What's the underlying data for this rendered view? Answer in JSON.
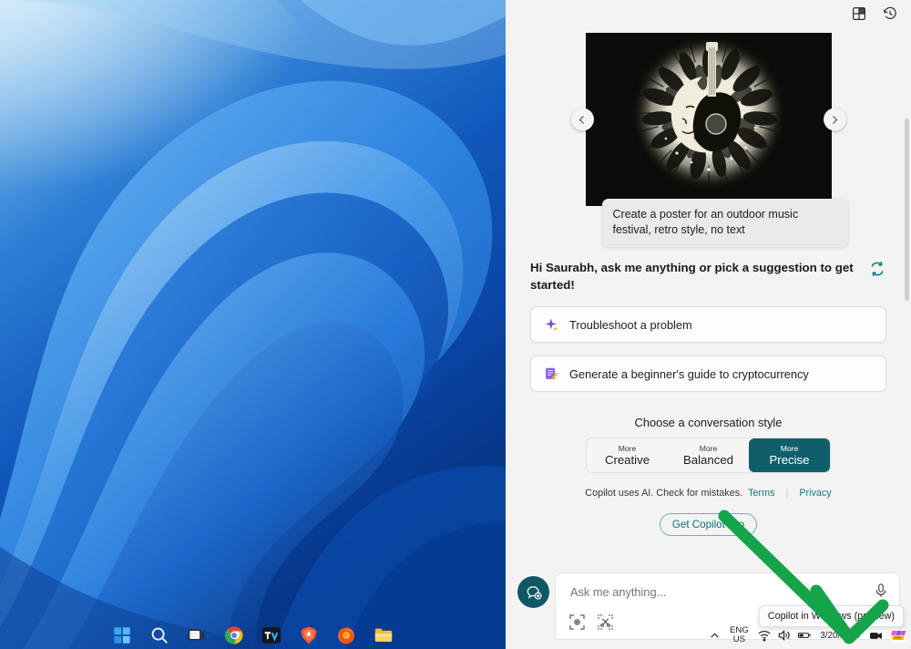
{
  "desktop": {
    "wallpaper_name": "windows-11-bloom-wallpaper",
    "taskbar": {
      "items": [
        {
          "name": "start-button",
          "label": "Start"
        },
        {
          "name": "search-button",
          "label": "Search"
        },
        {
          "name": "task-view-button",
          "label": "Task View"
        },
        {
          "name": "chrome-button",
          "label": "Google Chrome"
        },
        {
          "name": "tradingview-button",
          "label": "TradingView"
        },
        {
          "name": "brave-button",
          "label": "Brave Browser"
        },
        {
          "name": "firefox-button",
          "label": "Firefox"
        },
        {
          "name": "file-explorer-button",
          "label": "File Explorer"
        }
      ]
    },
    "tray": {
      "chevron_label": "Show hidden icons",
      "language": {
        "line1": "ENG",
        "line2": "US"
      },
      "wifi_label": "Network",
      "volume_label": "Volume",
      "battery_label": "Battery",
      "date": "3/20/2024",
      "meet_now_label": "Meet Now",
      "copilot_label": "Copilot in Windows (preview)",
      "tooltip": "Copilot in Windows (preview)"
    }
  },
  "copilot": {
    "topbar": {
      "plugins_label": "Plugins",
      "history_label": "Recent activity"
    },
    "carousel": {
      "prev_label": "Previous",
      "next_label": "Next",
      "caption": "Create a poster for an outdoor music festival, retro style, no text",
      "image_alt": "Retro black and white sun, moon and guitar poster"
    },
    "greeting": "Hi Saurabh, ask me anything or pick a suggestion to get started!",
    "refresh_label": "Refresh suggestions",
    "suggestions": [
      {
        "icon": "sparkle-icon",
        "label": "Troubleshoot a problem"
      },
      {
        "icon": "document-edit-icon",
        "label": "Generate a beginner's guide to cryptocurrency"
      }
    ],
    "style": {
      "title": "Choose a conversation style",
      "options": [
        {
          "more": "More",
          "name": "Creative",
          "selected": false
        },
        {
          "more": "More",
          "name": "Balanced",
          "selected": false
        },
        {
          "more": "More",
          "name": "Precise",
          "selected": true
        }
      ],
      "selected_color": "#0f5f6b"
    },
    "disclaimer": {
      "text": "Copilot uses AI. Check for mistakes.",
      "terms": "Terms",
      "privacy": "Privacy"
    },
    "pro_button": "Get Copilot Pro",
    "composer": {
      "new_chat_label": "New topic",
      "placeholder": "Ask me anything...",
      "value": "",
      "mic_label": "Use microphone",
      "scan_label": "Scan screen",
      "snip_label": "Snip screen"
    }
  },
  "annotation": {
    "type": "green-arrow",
    "color": "#16a44a",
    "points_to": "copilot-taskbar-icon"
  }
}
